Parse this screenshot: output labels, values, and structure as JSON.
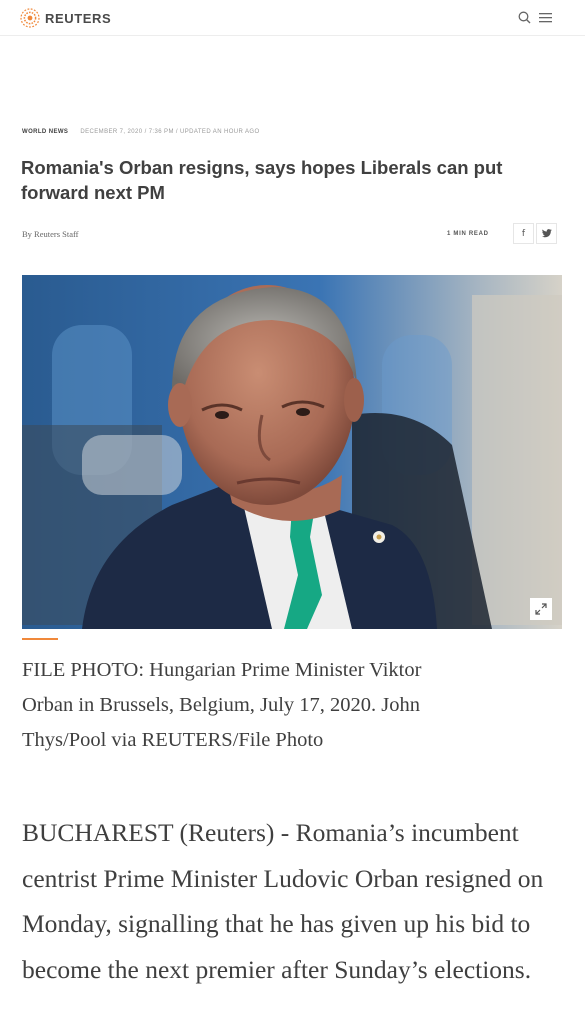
{
  "header": {
    "brand": "REUTERS",
    "icons": [
      "reuters-logo-icon",
      "search-icon",
      "menu-icon"
    ]
  },
  "article": {
    "section": "WORLD NEWS",
    "dateline": "DECEMBER 7, 2020 / 7:36 PM / UPDATED AN HOUR AGO",
    "headline": "Romania's Orban resigns, says hopes Liberals can put forward next PM",
    "byline": "By Reuters Staff",
    "read_time": "1 MIN READ",
    "share": {
      "facebook": "f",
      "twitter": "twitter-icon"
    },
    "caption": "FILE PHOTO: Hungarian Prime Minister Viktor Orban in Brussels, Belgium, July 17, 2020. John Thys/Pool via REUTERS/File Photo",
    "body": "BUCHAREST (Reuters) - Romania’s incumbent centrist Prime Minister Ludovic Orban resigned on Monday, signalling that he has given up his bid to become the next premier after Sunday’s elections."
  },
  "colors": {
    "brand_orange": "#f0883a",
    "text_dark": "#404040",
    "photo_background": "#2f5f93",
    "tie_green": "#16a884"
  }
}
